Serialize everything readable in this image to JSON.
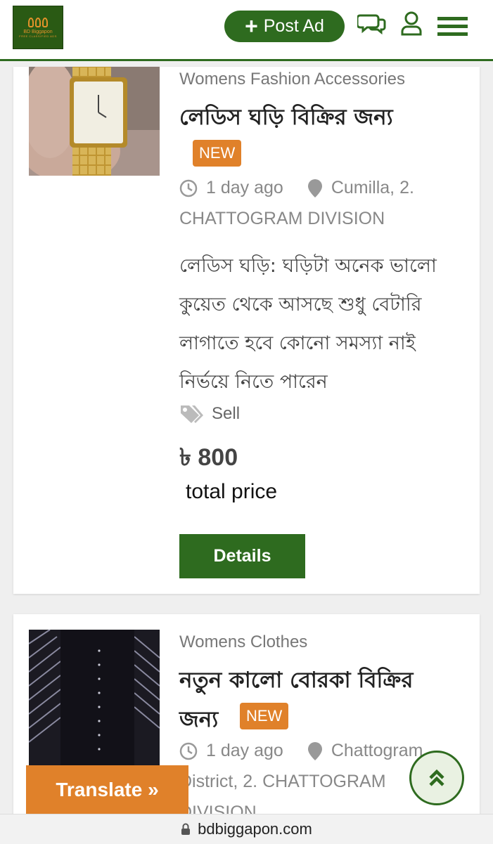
{
  "header": {
    "logo_name": "BD Biggapon",
    "logo_tagline": "FREE CLASSIFIED ADS",
    "post_ad_label": "Post Ad",
    "brand_color": "#2e6b1f",
    "icons": [
      "chat-icon",
      "user-icon",
      "menu-icon"
    ]
  },
  "listings": [
    {
      "category": "Womens Fashion Accessories",
      "title": "লেডিস ঘড়ি বিক্রির জন্য",
      "badge": "NEW",
      "time": "1 day ago",
      "location_line1": "Cumilla, 2.",
      "location_line2": "CHATTOGRAM DIVISION",
      "description_lines": [
        "লেডিস ঘড়ি: ঘড়িটা অনেক ভালো",
        "কুয়েত থেকে আসছে শুধু বেটারি",
        "লাগাতে হবে কোনো সমস্যা নাই",
        "নির্ভয়ে নিতে পারেন"
      ],
      "tag": "Sell",
      "price": "৳ 800",
      "price_note": "total price",
      "details_label": "Details"
    },
    {
      "category": "Womens Clothes",
      "title_line1": "নতুন কালো বোরকা বিক্রির",
      "title_line2": "জন্য",
      "badge": "NEW",
      "time": "1 day ago",
      "location_line1": "Chattogram",
      "location_line2": "District, 2. CHATTOGRAM",
      "location_line3": "DIVISION"
    }
  ],
  "translate_label": "Translate »",
  "url": "bdbiggapon.com",
  "accent_orange": "#e0812a"
}
